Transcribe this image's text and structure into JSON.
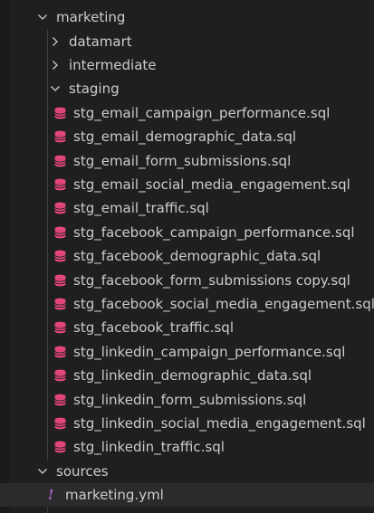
{
  "tree": {
    "marketing": "marketing",
    "datamart": "datamart",
    "intermediate": "intermediate",
    "staging": "staging",
    "staging_files": [
      "stg_email_campaign_performance.sql",
      "stg_email_demographic_data.sql",
      "stg_email_form_submissions.sql",
      "stg_email_social_media_engagement.sql",
      "stg_email_traffic.sql",
      "stg_facebook_campaign_performance.sql",
      "stg_facebook_demographic_data.sql",
      "stg_facebook_form_submissions copy.sql",
      "stg_facebook_social_media_engagement.sql",
      "stg_facebook_traffic.sql",
      "stg_linkedin_campaign_performance.sql",
      "stg_linkedin_demographic_data.sql",
      "stg_linkedin_form_submissions.sql",
      "stg_linkedin_social_media_engagement.sql",
      "stg_linkedin_traffic.sql"
    ],
    "sources": "sources",
    "sources_files": [
      "marketing.yml"
    ]
  },
  "icons": {
    "expanded": "chevron-down-icon",
    "collapsed": "chevron-right-icon",
    "sql": "database-icon",
    "yml": "yaml-icon"
  },
  "colors": {
    "background": "#1f1f1f",
    "text": "#cccccc",
    "sql_icon": "#e5477a",
    "yml_icon": "#b169d8",
    "selected_row": "#2b2b2b"
  }
}
